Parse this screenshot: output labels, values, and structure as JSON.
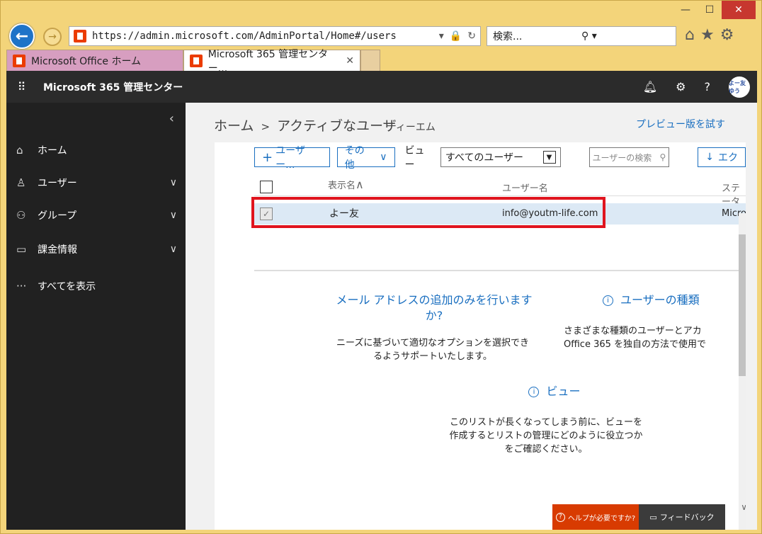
{
  "browser": {
    "url": "https://admin.microsoft.com/AdminPortal/Home#/users",
    "search_placeholder": "検索...",
    "tabs": [
      {
        "label": "Microsoft Office ホーム"
      },
      {
        "label": "Microsoft 365 管理センター..."
      }
    ]
  },
  "app": {
    "title": "Microsoft 365 管理センター",
    "avatar_text": "よー友ゆう"
  },
  "sidebar": {
    "items": [
      {
        "label": "ホーム"
      },
      {
        "label": "ユーザー"
      },
      {
        "label": "グループ"
      },
      {
        "label": "課金情報"
      },
      {
        "label": "すべてを表示"
      }
    ]
  },
  "breadcrumb": {
    "home": "ホーム",
    "separator": ">",
    "current": "アクティブなユーザ",
    "tenant": "ティーエム"
  },
  "preview_link": "プレビュー版を試す",
  "toolbar": {
    "add_user": "ユーザー...",
    "more": "その他",
    "view_label": "ビュー",
    "view_selected": "すべてのユーザー",
    "search_placeholder": "ユーザーの検索",
    "export": "エク"
  },
  "table": {
    "columns": [
      "表示名",
      "ユーザー名",
      "ステータ"
    ],
    "rows": [
      {
        "display_name": "よー友",
        "username": "info@youtm-life.com",
        "status": "Micro"
      }
    ]
  },
  "info": {
    "mail_heading": "メール アドレスの追加のみを行いますか?",
    "mail_text": "ニーズに基づいて適切なオプションを選択できるようサポートいたします。",
    "types_heading": "ユーザーの種類",
    "types_text_1": "さまざまな種類のユーザーとアカ",
    "types_text_2": "Office 365 を独自の方法で使用で",
    "view_heading": "ビュー",
    "view_text": "このリストが長くなってしまう前に、ビューを作成するとリストの管理にどのように役立つかをご確認ください。"
  },
  "footer": {
    "help": "ヘルプが必要ですか?",
    "feedback": "フィードバック"
  },
  "colors": {
    "accent": "#1a6fc0",
    "sidebar": "#212121",
    "topbar": "#2b2b2b",
    "help": "#d83b01",
    "highlight": "#e0141e"
  }
}
